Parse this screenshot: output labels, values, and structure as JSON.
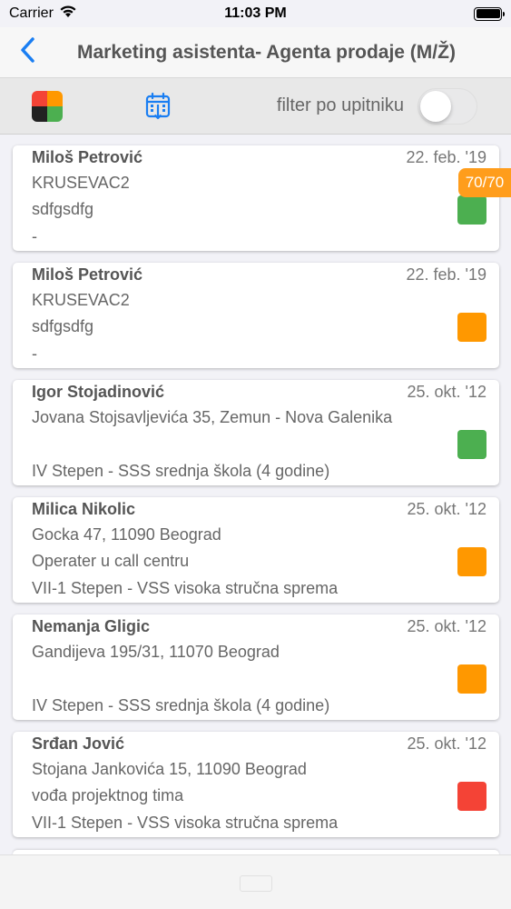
{
  "status_bar": {
    "carrier": "Carrier",
    "time": "11:03 PM"
  },
  "nav": {
    "title": "Marketing asistenta- Agenta prodaje (M/Ž)"
  },
  "toolbar": {
    "filter_label": "filter po upitniku",
    "filter_enabled": false
  },
  "score_badge": "70/70",
  "colors": {
    "accent": "#1a7ef2",
    "green": "#4caf50",
    "orange": "#ff9800",
    "red": "#f44336",
    "badge": "#ff9d1c"
  },
  "candidates": [
    {
      "name": "Miloš Petrović",
      "date": "22. feb. '19",
      "line1": "KRUSEVAC2",
      "line2": "sdfgsdfg",
      "line3": "-",
      "status": "green"
    },
    {
      "name": "Miloš Petrović",
      "date": "22. feb. '19",
      "line1": "KRUSEVAC2",
      "line2": "sdfgsdfg",
      "line3": "-",
      "status": "orange"
    },
    {
      "name": "Igor Stojadinović",
      "date": "25. okt. '12",
      "line1": "Jovana Stojsavljevića 35, Zemun - Nova Galenika",
      "line2": "",
      "line3": "IV Stepen - SSS srednja škola (4 godine)",
      "status": "green"
    },
    {
      "name": "Milica Nikolic",
      "date": "25. okt. '12",
      "line1": "Gocka 47, 11090 Beograd",
      "line2": "Operater u call centru",
      "line3": "VII-1 Stepen - VSS visoka stručna sprema",
      "status": "orange"
    },
    {
      "name": "Nemanja Gligic",
      "date": "25. okt. '12",
      "line1": "Gandijeva 195/31, 11070 Beograd",
      "line2": "",
      "line3": "IV Stepen - SSS srednja škola (4 godine)",
      "status": "orange"
    },
    {
      "name": "Srđan Jović",
      "date": "25. okt. '12",
      "line1": "Stojana Jankovića 15, 11090 Beograd",
      "line2": "vođa projektnog tima",
      "line3": "VII-1 Stepen - VSS visoka stručna sprema",
      "status": "red"
    }
  ]
}
